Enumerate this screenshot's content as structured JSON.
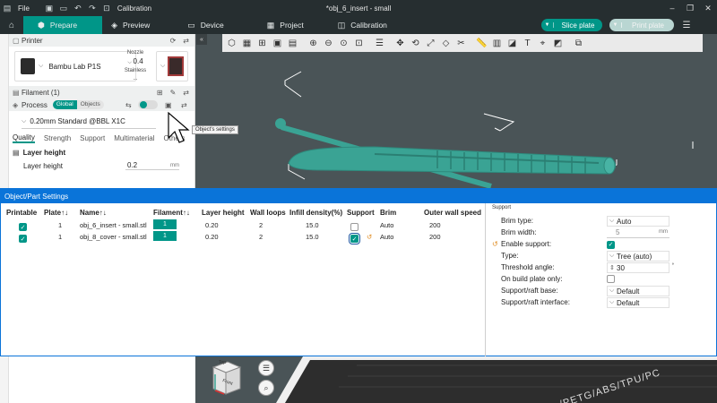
{
  "window": {
    "menu_label": "File",
    "calibration_label": "Calibration",
    "doc_title": "*obj_6_insert - small"
  },
  "tabs": [
    {
      "label": "Prepare",
      "icon": "cube-icon",
      "active": true
    },
    {
      "label": "Preview",
      "icon": "layers-icon",
      "active": false
    },
    {
      "label": "Device",
      "icon": "monitor-icon",
      "active": false
    },
    {
      "label": "Project",
      "icon": "grid-icon",
      "active": false
    },
    {
      "label": "Calibration",
      "icon": "tuning-icon",
      "active": false
    }
  ],
  "actions": {
    "slice_plate": "Slice plate",
    "print_plate": "Print plate"
  },
  "sidebar": {
    "printer_title": "Printer",
    "printer_name": "Bambu Lab P1S",
    "nozzle_label": "Nozzle",
    "nozzle_value": "0.4",
    "nozzle_material": "Stainless ...",
    "filament_title": "Filament (1)",
    "process_title": "Process",
    "toggle_global": "Global",
    "toggle_objects": "Objects",
    "process_preset": "0.20mm Standard @BBL X1C",
    "subtabs": [
      "Quality",
      "Strength",
      "Support",
      "Multimaterial",
      "Others"
    ],
    "layer_height_section": "Layer height",
    "layer_height_label": "Layer height",
    "layer_height_value": "0.2",
    "layer_height_unit": "mm",
    "tooltip": "Object's settings"
  },
  "viewport": {
    "plate_text": "/PETG/ABS/TPU/PC",
    "cube_top": "Top",
    "cube_front": "Front"
  },
  "dialog": {
    "title": "Object/Part Settings",
    "columns": [
      "Printable",
      "Plate↑↓",
      "Name↑↓",
      "Filament↑↓",
      "Layer height",
      "Wall loops",
      "Infill density(%)",
      "Support",
      "Brim",
      "Outer wall speed"
    ],
    "rows": [
      {
        "printable": true,
        "plate": "1",
        "name": "obj_6_insert - small.stl",
        "filament": "1",
        "layer_height": "0.20",
        "wall_loops": "2",
        "infill": "15.0",
        "support": false,
        "brim": "Auto",
        "outer_wall_speed": "200"
      },
      {
        "printable": true,
        "plate": "1",
        "name": "obj_8_cover - small.stl",
        "filament": "1",
        "layer_height": "0.20",
        "wall_loops": "2",
        "infill": "15.0",
        "support": true,
        "brim": "Auto",
        "outer_wall_speed": "200"
      }
    ],
    "panel": {
      "title": "Support",
      "brim_type_label": "Brim type:",
      "brim_type_value": "Auto",
      "brim_width_label": "Brim width:",
      "brim_width_value": "5",
      "brim_width_unit": "mm",
      "enable_support_label": "Enable support:",
      "type_label": "Type:",
      "type_value": "Tree (auto)",
      "threshold_label": "Threshold angle:",
      "threshold_value": "30",
      "threshold_unit": "°",
      "on_build_plate_label": "On build plate only:",
      "raft_base_label": "Support/raft base:",
      "raft_base_value": "Default",
      "raft_interface_label": "Support/raft interface:",
      "raft_interface_value": "Default"
    }
  },
  "colors": {
    "accent": "#009688",
    "dialog_border": "#0a74d9",
    "model": "#3aa394",
    "viewport_bg": "#4a5457"
  }
}
